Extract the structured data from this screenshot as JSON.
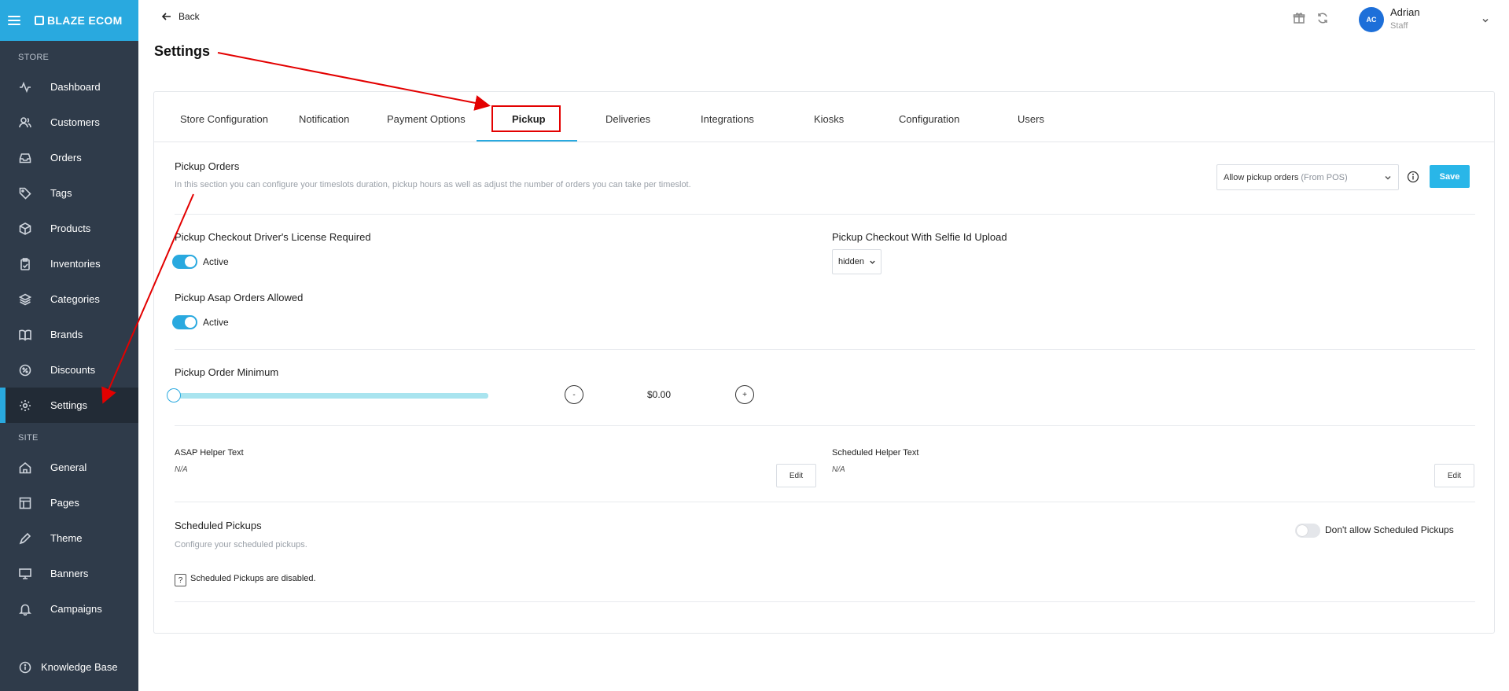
{
  "sidebar": {
    "brand": "BLAZE ECOM",
    "store_label": "STORE",
    "site_label": "SITE",
    "store_items": [
      {
        "label": "Dashboard",
        "icon": "activity-icon"
      },
      {
        "label": "Customers",
        "icon": "users-icon"
      },
      {
        "label": "Orders",
        "icon": "inbox-icon"
      },
      {
        "label": "Tags",
        "icon": "tag-icon"
      },
      {
        "label": "Products",
        "icon": "box-icon"
      },
      {
        "label": "Inventories",
        "icon": "clipboard-icon"
      },
      {
        "label": "Categories",
        "icon": "layers-icon"
      },
      {
        "label": "Brands",
        "icon": "book-icon"
      },
      {
        "label": "Discounts",
        "icon": "percent-icon"
      },
      {
        "label": "Settings",
        "icon": "gear-icon",
        "active": true
      }
    ],
    "site_items": [
      {
        "label": "General",
        "icon": "home-icon"
      },
      {
        "label": "Pages",
        "icon": "layout-icon"
      },
      {
        "label": "Theme",
        "icon": "pen-icon"
      },
      {
        "label": "Banners",
        "icon": "monitor-icon"
      },
      {
        "label": "Campaigns",
        "icon": "bell-icon"
      }
    ],
    "knowledge_base": "Knowledge Base"
  },
  "header": {
    "back_label": "Back",
    "page_title": "Settings",
    "user": {
      "initials": "AC",
      "name": "Adrian",
      "role": "Staff"
    }
  },
  "tabs": [
    {
      "label": "Store Configuration"
    },
    {
      "label": "Notification"
    },
    {
      "label": "Payment Options"
    },
    {
      "label": "Pickup",
      "active": true
    },
    {
      "label": "Deliveries"
    },
    {
      "label": "Integrations"
    },
    {
      "label": "Kiosks"
    },
    {
      "label": "Configuration"
    },
    {
      "label": "Users"
    }
  ],
  "pickup": {
    "title": "Pickup Orders",
    "description": "In this section you can configure your timeslots duration, pickup hours as well as adjust the number of orders you can take per timeslot.",
    "mode_select": {
      "value": "Allow pickup orders",
      "suffix": "(From POS)"
    },
    "save_label": "Save",
    "license_required": {
      "title": "Pickup Checkout Driver's License Required",
      "state": "Active",
      "on": true
    },
    "selfie_upload": {
      "title": "Pickup Checkout With Selfie Id Upload",
      "value": "hidden"
    },
    "asap_allowed": {
      "title": "Pickup Asap Orders Allowed",
      "state": "Active",
      "on": true
    },
    "order_minimum": {
      "title": "Pickup Order Minimum",
      "minus": "-",
      "plus": "+",
      "amount": "$0.00",
      "slider_fraction": 0
    },
    "asap_helper": {
      "label": "ASAP Helper Text",
      "value": "N/A",
      "edit_label": "Edit"
    },
    "scheduled_helper": {
      "label": "Scheduled Helper Text",
      "value": "N/A",
      "edit_label": "Edit"
    },
    "scheduled": {
      "title": "Scheduled Pickups",
      "description": "Configure your scheduled pickups.",
      "toggle_label": "Don't allow Scheduled Pickups",
      "toggle_on": false,
      "disabled_note": "Scheduled Pickups are disabled.",
      "question_glyph": "?"
    }
  },
  "colors": {
    "accent": "#29a9df",
    "sidebar": "#2f3b4a",
    "annotation": "#e30000"
  }
}
